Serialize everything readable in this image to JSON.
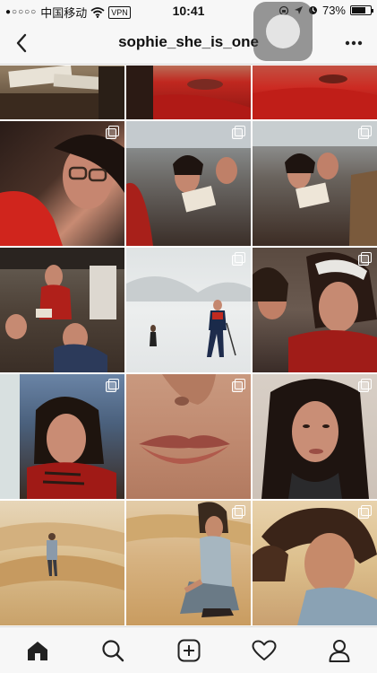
{
  "status_bar": {
    "signal": "●○○○○",
    "carrier": "中国移动",
    "vpn": "VPN",
    "time": "10:41",
    "battery_percent": "73%",
    "battery_level": 0.73
  },
  "nav": {
    "title": "sophie_she_is_one",
    "back_icon": "chevron-left-icon",
    "more_icon": "more-dots-icon"
  },
  "grid": {
    "rows": 5,
    "columns": 3,
    "tiles": [
      {
        "desc": "desk",
        "multi": false
      },
      {
        "desc": "lips-red-jacket",
        "multi": false
      },
      {
        "desc": "red-jacket-face",
        "multi": false
      },
      {
        "desc": "kiss-glasses",
        "multi": true
      },
      {
        "desc": "metro-reading",
        "multi": true
      },
      {
        "desc": "metro-reading-2",
        "multi": true
      },
      {
        "desc": "crowd-street",
        "multi": false
      },
      {
        "desc": "snow-skiing",
        "multi": true
      },
      {
        "desc": "red-scarf-headband",
        "multi": true
      },
      {
        "desc": "girl-red-scarf",
        "multi": true
      },
      {
        "desc": "lips-closeup",
        "multi": true
      },
      {
        "desc": "portrait-dark-hair",
        "multi": true
      },
      {
        "desc": "desert-walker",
        "multi": false
      },
      {
        "desc": "desert-kneeling",
        "multi": true
      },
      {
        "desc": "desert-hair-wind",
        "multi": true
      }
    ]
  },
  "tab_bar": {
    "items": [
      "home-icon",
      "search-icon",
      "add-post-icon",
      "heart-icon",
      "profile-icon"
    ]
  },
  "colors": {
    "bar_background": "#f7f7f7",
    "divider": "#d9d9d9",
    "icon": "#222222"
  }
}
